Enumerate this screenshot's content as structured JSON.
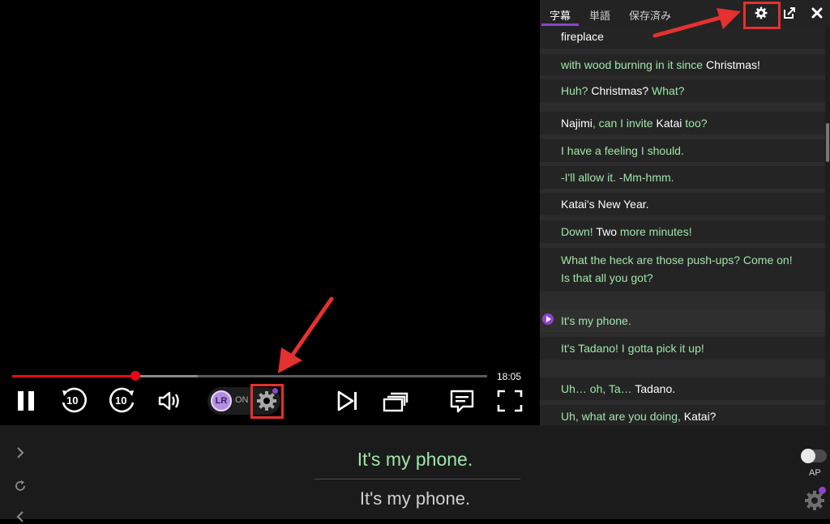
{
  "player": {
    "time_remaining": "18:05",
    "progress_fraction": 0.259,
    "buffer_fraction": 0.39,
    "rewind_label": "10",
    "forward_label": "10",
    "lr_logo_text": "LR",
    "lr_status": "ON"
  },
  "panel": {
    "tabs": [
      {
        "label": "字幕"
      },
      {
        "label": "単語"
      },
      {
        "label": "保存済み"
      }
    ],
    "subtitles": [
      {
        "text": "fireplace",
        "words": [
          {
            "t": "fireplace",
            "known": true
          }
        ]
      },
      {
        "words": [
          {
            "t": "with wood burning in it since ",
            "known": false
          },
          {
            "t": "Christmas!",
            "known": true
          }
        ]
      },
      {
        "words": [
          {
            "t": "Huh? ",
            "known": false
          },
          {
            "t": "Christmas?",
            "known": true
          },
          {
            "t": " What?",
            "known": false
          }
        ]
      },
      {
        "words": [
          {
            "t": "Najimi",
            "known": true
          },
          {
            "t": ", can I invite ",
            "known": false
          },
          {
            "t": "Katai",
            "known": true
          },
          {
            "t": " too?",
            "known": false
          }
        ]
      },
      {
        "words": [
          {
            "t": "I have a feeling I should.",
            "known": false
          }
        ]
      },
      {
        "words": [
          {
            "t": "-I'll allow it. -Mm-hmm.",
            "known": false
          }
        ]
      },
      {
        "words": [
          {
            "t": "Katai's New Year.",
            "known": true
          }
        ]
      },
      {
        "words": [
          {
            "t": "Down!",
            "known": false
          },
          {
            "t": " Two ",
            "known": true
          },
          {
            "t": "more minutes!",
            "known": false
          }
        ]
      },
      {
        "words": [
          {
            "t": "What the heck are those push-ups? Come on! Is that all you got?",
            "known": false
          }
        ]
      },
      {
        "words": [
          {
            "t": "It's my phone.",
            "known": false
          }
        ]
      },
      {
        "words": [
          {
            "t": "It's Tadano! I gotta pick it up!",
            "known": false
          }
        ]
      },
      {
        "words": [
          {
            "t": "Uh… oh, Ta… ",
            "known": false
          },
          {
            "t": "Tadano.",
            "known": true
          }
        ]
      },
      {
        "words": [
          {
            "t": "Uh, what are you doing, ",
            "known": false
          },
          {
            "t": "Katai?",
            "known": true
          }
        ]
      }
    ]
  },
  "bottom": {
    "line1_words": [
      {
        "t": "It's ",
        "known": false
      },
      {
        "t": "my phone.",
        "known": false
      }
    ],
    "line2": "It's my phone.",
    "ap_label": "AP"
  },
  "colors": {
    "accent": "#8e44c9",
    "progress": "#e50914",
    "learn_word": "#9de6a8",
    "highlight_box": "#e5312f"
  }
}
